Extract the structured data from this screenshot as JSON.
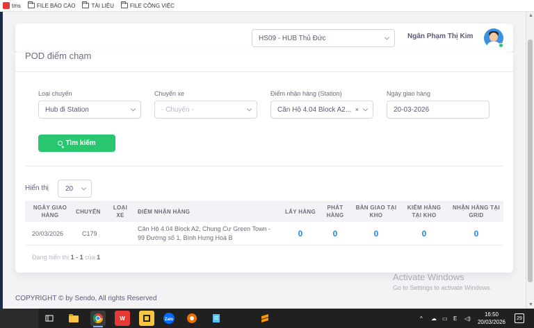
{
  "bookmarks": [
    {
      "label": "tms",
      "icon": "tms-favicon"
    },
    {
      "label": "FILE BÁO CÁO",
      "icon": "folder-icon"
    },
    {
      "label": "TÀI LIỆU",
      "icon": "folder-icon"
    },
    {
      "label": "FILE CÔNG VIỆC",
      "icon": "folder-icon"
    }
  ],
  "header": {
    "hub": "HS09 - HUB Thủ Đức",
    "user_name": "Ngân Phạm Thị Kim"
  },
  "page": {
    "title": "POD điểm chạm"
  },
  "filters": {
    "route_type": {
      "label": "Loại chuyến",
      "value": "Hub đi Station"
    },
    "trip": {
      "label": "Chuyến xe",
      "placeholder": "- Chuyến -"
    },
    "station": {
      "label": "Điểm nhận hàng (Station)",
      "value": "Căn Hộ 4.04 Block A2..."
    },
    "date": {
      "label": "Ngày giao hàng",
      "value": "20-03-2026"
    },
    "search_label": "Tìm kiếm"
  },
  "table": {
    "show_label": "Hiển thị",
    "page_size": "20",
    "columns": [
      "NGÀY GIAO HÀNG",
      "CHUYẾN",
      "LOẠI XE",
      "ĐIỂM NHẬN HÀNG",
      "LẤY HÀNG",
      "PHÁT HÀNG",
      "BÀN GIAO TẠI KHO",
      "KIỂM HÀNG TẠI KHO",
      "NHẬN HÀNG TẠI GRID"
    ],
    "rows": [
      {
        "date": "20/03/2026",
        "trip": "C179",
        "vehicle": "",
        "address": "Căn Hộ 4.04 Block A2, Chung Cư Green Town - 99 Đường số 1, Bình Hưng Hoà B",
        "pickup": "0",
        "delivery": "0",
        "handover": "0",
        "check": "0",
        "grid": "0"
      }
    ],
    "pager_prefix": "Đang hiển thị",
    "pager_range": "1 - 1",
    "pager_of": "của",
    "pager_total": "1"
  },
  "footer": {
    "copyright": "COPYRIGHT © by Sendo, All rights Reserved"
  },
  "watermark": {
    "title": "Activate Windows",
    "subtitle": "Go to Settings to activate Windows."
  },
  "taskbar": {
    "apps": [
      "task-view",
      "file-explorer",
      "chrome",
      "wps-office",
      "sticky-notes",
      "zalo",
      "app-orange",
      "notepad",
      "sublime"
    ],
    "time": "16:50",
    "date": "20/03/2026",
    "notifications": "29"
  },
  "colors": {
    "accent_green": "#28c76f",
    "link_blue": "#1e88e5",
    "text": "#5e5873",
    "background": "#f3f3f6"
  }
}
